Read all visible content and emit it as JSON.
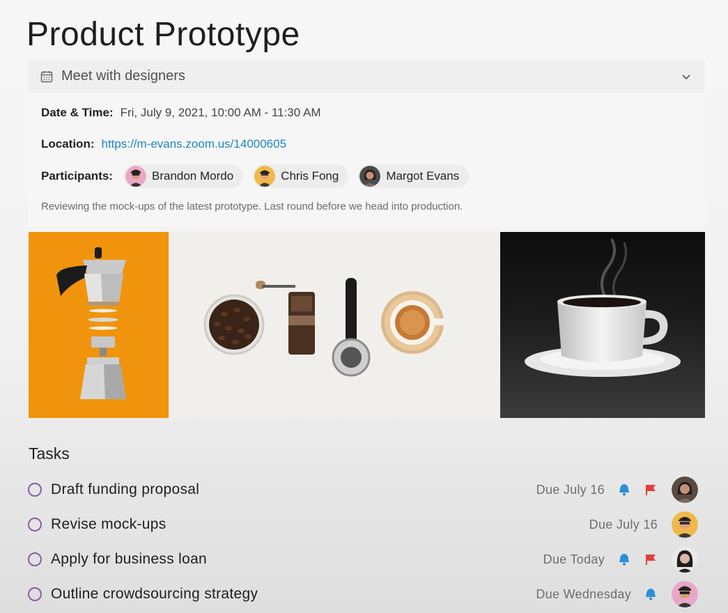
{
  "page": {
    "title": "Product Prototype"
  },
  "meeting": {
    "title": "Meet with designers",
    "datetime_label": "Date & Time:",
    "datetime_value": "Fri, July 9, 2021, 10:00 AM - 11:30 AM",
    "location_label": "Location:",
    "location_value": "https://m-evans.zoom.us/14000605",
    "participants_label": "Participants:",
    "participants": [
      {
        "name": "Brandon Mordo",
        "avatar_bg": "#e9a7c7"
      },
      {
        "name": "Chris Fong",
        "avatar_bg": "#f0b94a"
      },
      {
        "name": "Margot Evans",
        "avatar_bg": "#4a4a4a"
      }
    ],
    "description": "Reviewing the mock-ups of the latest prototype. Last round before we head into production."
  },
  "images": [
    {
      "name": "moka-pot-photo",
      "bg": "#f0940e"
    },
    {
      "name": "coffee-flatlay-photo",
      "bg": "#f1efec"
    },
    {
      "name": "coffee-cup-photo",
      "bg": "#141414"
    }
  ],
  "tasks_section": {
    "title": "Tasks",
    "items": [
      {
        "label": "Draft funding proposal",
        "due": "Due July 16",
        "bell": true,
        "flag": true,
        "avatar_bg": "#5a4a40"
      },
      {
        "label": "Revise mock-ups",
        "due": "Due July 16",
        "bell": false,
        "flag": false,
        "avatar_bg": "#f0b94a"
      },
      {
        "label": "Apply for business loan",
        "due": "Due Today",
        "bell": true,
        "flag": true,
        "avatar_bg": "#e9e9e9"
      },
      {
        "label": "Outline crowdsourcing strategy",
        "due": "Due Wednesday",
        "bell": true,
        "flag": false,
        "avatar_bg": "#e9a7c7"
      }
    ]
  },
  "colors": {
    "accent_link": "#1f86c2",
    "checkbox": "#8a5ba6",
    "bell": "#2a8fd6",
    "flag": "#e0403a"
  }
}
